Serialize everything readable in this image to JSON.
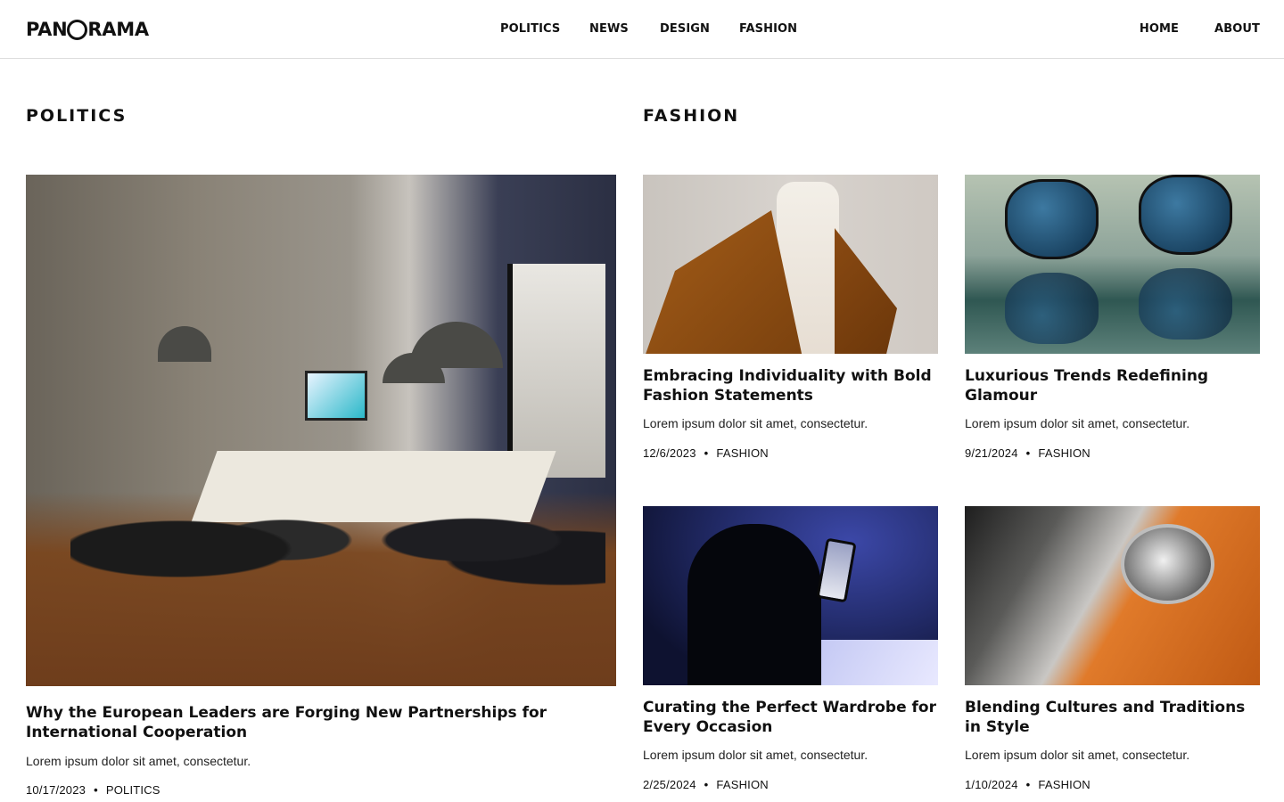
{
  "header": {
    "logo": {
      "prefix": "PAN",
      "suffix": "RAMA"
    },
    "nav_center": [
      "POLITICS",
      "NEWS",
      "DESIGN",
      "FASHION"
    ],
    "nav_right": [
      "HOME",
      "ABOUT"
    ]
  },
  "sections": {
    "politics": {
      "title": "POLITICS"
    },
    "fashion": {
      "title": "FASHION"
    }
  },
  "articles": {
    "politics_main": {
      "title": "Why the European Leaders are Forging New Partnerships for International Cooperation",
      "excerpt": "Lorem ipsum dolor sit amet, consectetur.",
      "date": "10/17/2023",
      "category": "POLITICS"
    },
    "fashion_1": {
      "title": "Embracing Individuality with Bold Fashion Statements",
      "excerpt": "Lorem ipsum dolor sit amet, consectetur.",
      "date": "12/6/2023",
      "category": "FASHION"
    },
    "fashion_2": {
      "title": "Luxurious Trends Redefining Glamour",
      "excerpt": "Lorem ipsum dolor sit amet, consectetur.",
      "date": "9/21/2024",
      "category": "FASHION"
    },
    "fashion_3": {
      "title": "Curating the Perfect Wardrobe for Every Occasion",
      "excerpt": "Lorem ipsum dolor sit amet, consectetur.",
      "date": "2/25/2024",
      "category": "FASHION"
    },
    "fashion_4": {
      "title": "Blending Cultures and Traditions in Style",
      "excerpt": "Lorem ipsum dolor sit amet, consectetur.",
      "date": "1/10/2024",
      "category": "FASHION"
    }
  },
  "meta_separator": "•"
}
